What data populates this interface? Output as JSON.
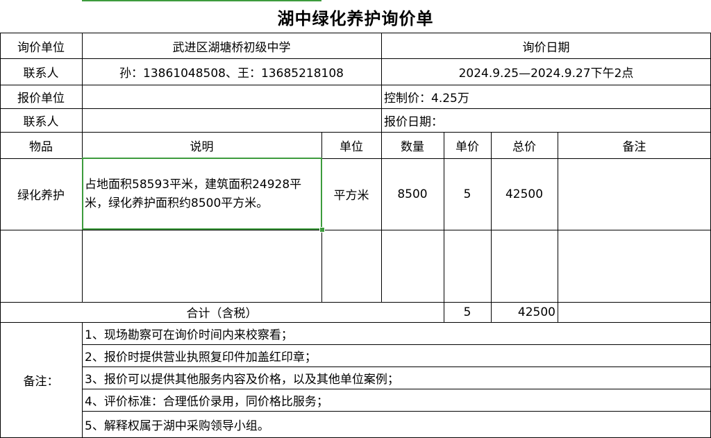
{
  "title": "湖中绿化养护询价单",
  "header": {
    "inquiry_unit_label": "询价单位",
    "inquiry_unit_value": "武进区湖塘桥初级中学",
    "inquiry_date_label": "询价日期",
    "contact_label": "联系人",
    "contact_value": "孙：13861048508、王：13685218108",
    "inquiry_date_value": "2024.9.25—2024.9.27下午2点",
    "quote_unit_label": "报价单位",
    "control_price": "控制价：4.25万",
    "contact2_label": "联系人",
    "quote_date": "报价日期："
  },
  "table": {
    "columns": [
      "物品",
      "说明",
      "单位",
      "数量",
      "单价",
      "总价",
      "备注"
    ],
    "rows": [
      {
        "item": "绿化养护",
        "description": "占地面积58593平米，建筑面积24928平米，绿化养护面积约8500平方米。",
        "unit": "平方米",
        "quantity": "8500",
        "unit_price": "5",
        "total": "42500",
        "remark": ""
      }
    ]
  },
  "summary": {
    "label": "合计（含税）",
    "unit_price": "5",
    "total": "42500"
  },
  "notes": {
    "label": "备注：",
    "items": [
      "1、现场勘察可在询价时间内来校察看；",
      "2、报价时提供营业执照复印件加盖红印章；",
      "3、报价可以提供其他服务内容及价格，以及其他单位案例；",
      "4、评价标准：合理低价录用，同价格比服务；",
      "5、解释权属于湖中采购领导小组。"
    ]
  },
  "colors": {
    "selection": "#3c9b3c",
    "grid": "#000000"
  }
}
